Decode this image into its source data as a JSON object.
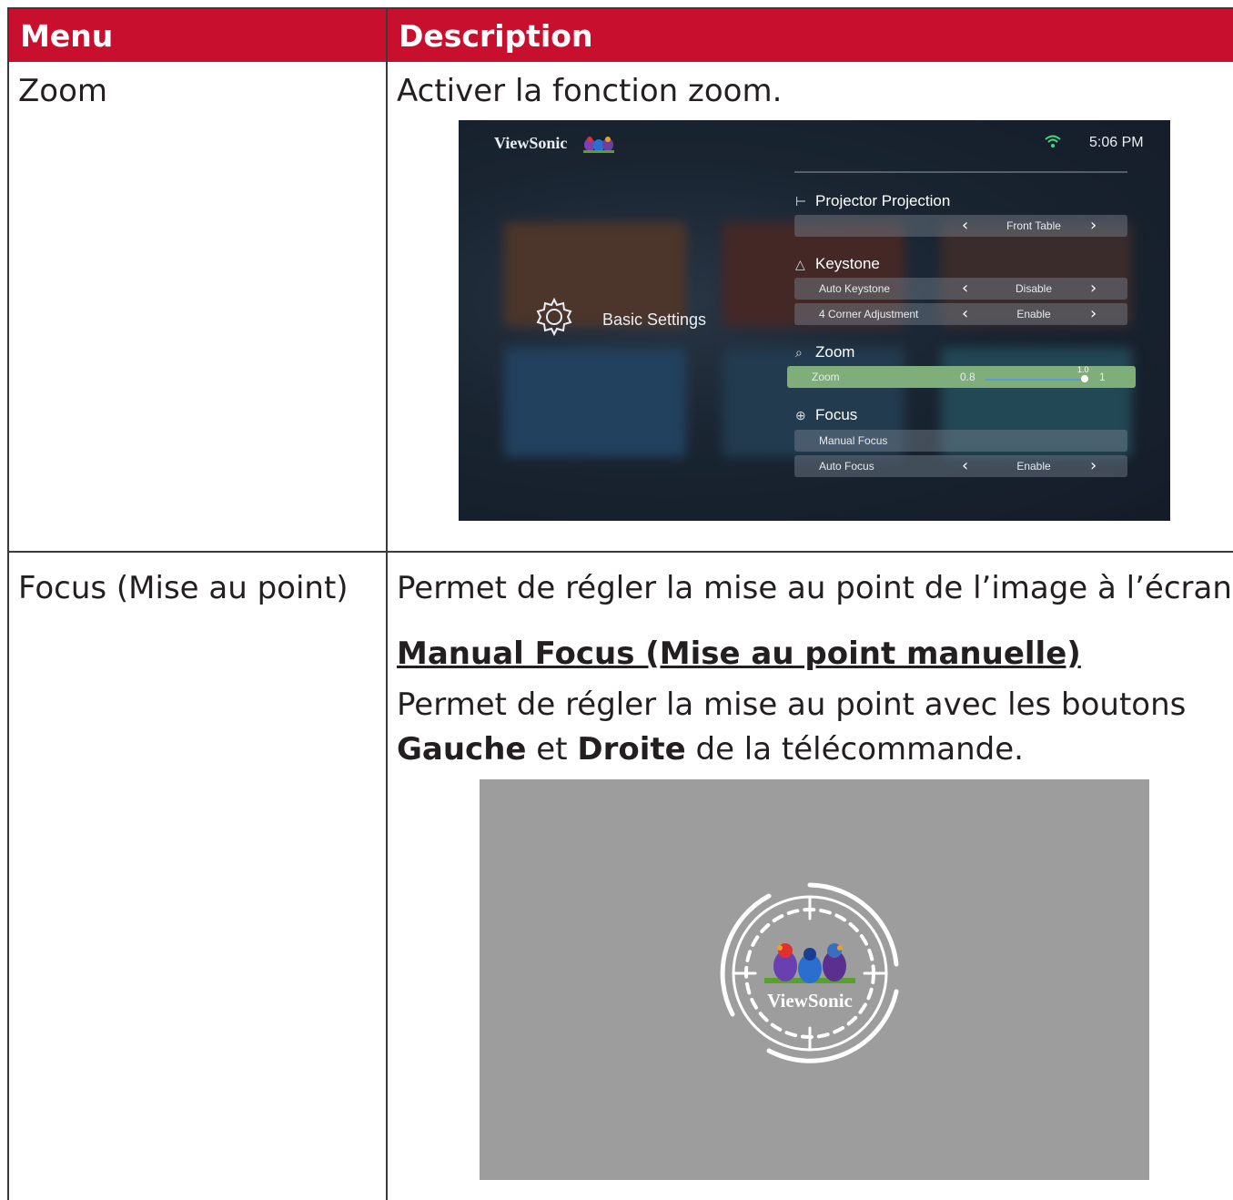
{
  "table": {
    "header": {
      "menu": "Menu",
      "description": "Description"
    },
    "rows": [
      {
        "menu": "Zoom",
        "description": "Activer la fonction zoom.",
        "screenshot": {
          "brand": "ViewSonic",
          "time": "5:06 PM",
          "category": "Basic Settings",
          "sections": [
            {
              "title": "Projector Projection",
              "icon": "projector-icon"
            },
            {
              "title": "Keystone",
              "icon": "keystone-icon"
            },
            {
              "title": "Zoom",
              "icon": "search-icon"
            },
            {
              "title": "Focus",
              "icon": "crosshair-icon"
            }
          ],
          "rows": {
            "projection": {
              "label": "",
              "value": "Front Table"
            },
            "auto_keystone": {
              "label": "Auto Keystone",
              "value": "Disable"
            },
            "corner": {
              "label": "4 Corner Adjustment",
              "value": "Enable"
            },
            "zoom": {
              "label": "Zoom",
              "min": "0.8",
              "current": "1.0",
              "max": "1"
            },
            "manual_focus": {
              "label": "Manual Focus"
            },
            "auto_focus": {
              "label": "Auto Focus",
              "value": "Enable"
            }
          },
          "zoom_level": 1.0,
          "colors": {
            "highlight": "#7fae7a",
            "wifi": "#3ddc84"
          }
        }
      },
      {
        "menu": "Focus (Mise au point)",
        "description": "Permet de régler la mise au point de l’image à l’écran.",
        "subsection_title": "Manual Focus (Mise au point manuelle)",
        "subsection_text_1": "Permet de régler la mise au point avec les boutons",
        "bold_left": "Gauche",
        "joiner": "et",
        "bold_right": "Droite",
        "subsection_text_2": "de la télécommande.",
        "focus_screen": {
          "brand": "ViewSonic"
        }
      }
    ]
  },
  "colors": {
    "header_bg": "#c8102e",
    "border": "#3a3a3a",
    "text": "#231f20"
  }
}
